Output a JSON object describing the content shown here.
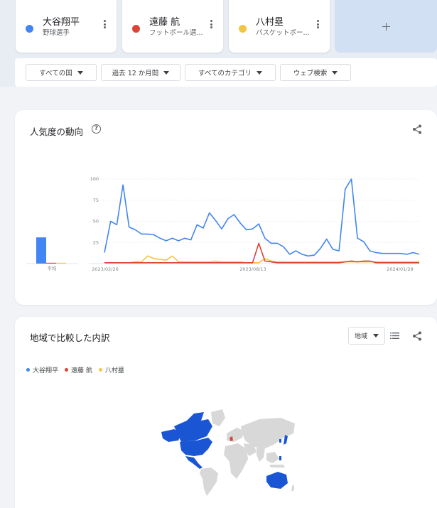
{
  "terms": [
    {
      "name": "大谷翔平",
      "subtitle": "野球選手",
      "color": "#4285f4"
    },
    {
      "name": "遠藤 航",
      "subtitle": "フットボール選...",
      "color": "#db4437"
    },
    {
      "name": "八村塁",
      "subtitle": "バスケットボー...",
      "color": "#f4c542"
    }
  ],
  "filters": {
    "region": "すべての国",
    "period": "過去 12 か月間",
    "category": "すべてのカテゴリ",
    "search_type": "ウェブ検索"
  },
  "trend_card": {
    "title": "人気度の動向",
    "help_label": "?",
    "average_label": "平均"
  },
  "chart_data": {
    "type": "line",
    "ylim": [
      0,
      100
    ],
    "y_ticks": [
      "100",
      "75",
      "50",
      "25"
    ],
    "x_tick_labels": [
      "2023/02/26",
      "2023/08/13",
      "2024/01/28"
    ],
    "averages": [
      {
        "name": "大谷翔平",
        "value": 31
      },
      {
        "name": "遠藤 航",
        "value": 1
      },
      {
        "name": "八村塁",
        "value": 1
      }
    ],
    "series": [
      {
        "name": "大谷翔平",
        "color": "#4285f4",
        "values": [
          13,
          50,
          46,
          93,
          43,
          40,
          35,
          35,
          34,
          30,
          27,
          30,
          27,
          30,
          28,
          46,
          42,
          60,
          51,
          41,
          53,
          58,
          48,
          40,
          41,
          47,
          30,
          24,
          24,
          20,
          11,
          15,
          11,
          9,
          10,
          18,
          29,
          17,
          15,
          88,
          100,
          30,
          26,
          15,
          13,
          12,
          12,
          12,
          12,
          11,
          13,
          11
        ]
      },
      {
        "name": "遠藤 航",
        "color": "#db4437",
        "values": [
          1,
          1,
          1,
          1,
          1,
          1,
          1,
          1,
          1,
          1,
          1,
          1,
          1,
          1,
          1,
          1,
          1,
          1,
          1,
          1,
          1,
          1,
          1,
          1,
          1,
          24,
          3,
          2,
          1,
          1,
          1,
          1,
          1,
          1,
          1,
          1,
          1,
          1,
          1,
          2,
          3,
          2,
          3,
          3,
          1,
          1,
          1,
          1,
          1,
          1,
          1,
          1
        ]
      },
      {
        "name": "八村塁",
        "color": "#f4c542",
        "values": [
          1,
          1,
          1,
          1,
          1,
          2,
          2,
          9,
          6,
          5,
          4,
          9,
          2,
          2,
          2,
          2,
          2,
          2,
          3,
          2,
          2,
          2,
          2,
          1,
          1,
          1,
          6,
          3,
          2,
          2,
          2,
          2,
          2,
          2,
          2,
          2,
          2,
          2,
          2,
          2,
          2,
          2,
          2,
          2,
          2,
          2,
          2,
          2,
          2,
          2,
          2,
          2
        ]
      }
    ]
  },
  "region_card": {
    "title": "地域で比較した内訳",
    "select_value": "地域"
  },
  "map_colors": {
    "base": "#d8d8d8",
    "ohtani": "#1a56d4",
    "endo": "#db4437"
  }
}
